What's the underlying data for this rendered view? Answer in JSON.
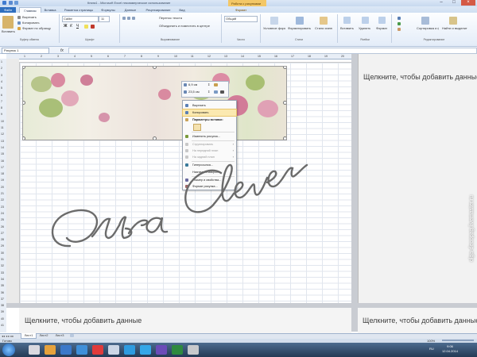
{
  "titlebar": {
    "title": "Книга1 - Microsoft Excel некоммерческое использование",
    "context_tab": "Работа с рисунками"
  },
  "tabs": {
    "file": "Файл",
    "items": [
      "Главная",
      "Вставка",
      "Разметка страницы",
      "Формулы",
      "Данные",
      "Рецензирование",
      "Вид",
      "Формат"
    ]
  },
  "ribbon": {
    "paste_label": "Вставить",
    "cut_label": "Вырезать",
    "copy_label": "Копировать",
    "format_painter_label": "Формат по образцу",
    "font_name": "Calibri",
    "font_size": "11",
    "wrap_label": "Перенос текста",
    "merge_label": "Объединить и поместить в центре",
    "number_format": "Общий",
    "conditional_label": "Условное форматирование",
    "format_table_label": "Форматировать как таблицу",
    "cell_styles_label": "Стили ячеек",
    "insert_label": "Вставить",
    "delete_label": "Удалить",
    "format_label": "Формат",
    "sort_label": "Сортировка и фильтр",
    "find_label": "Найти и выделить",
    "groups": [
      "Буфер обмена",
      "Шрифт",
      "Выравнивание",
      "Число",
      "Стили",
      "Ячейки",
      "Редактирование"
    ]
  },
  "formula_bar": {
    "name_box": "Рисунок 1",
    "fx": "fx"
  },
  "sheet": {
    "column_numbers": [
      "1",
      "2",
      "3",
      "4",
      "5",
      "6",
      "7",
      "8",
      "9",
      "10",
      "11",
      "12",
      "13",
      "14",
      "15",
      "16",
      "17",
      "18",
      "19",
      "20"
    ],
    "row_numbers": [
      "1",
      "2",
      "3",
      "4",
      "5",
      "6",
      "7",
      "8",
      "9",
      "10",
      "11",
      "12",
      "13",
      "14",
      "15",
      "16",
      "17",
      "18",
      "19",
      "20",
      "21",
      "22",
      "23",
      "24",
      "25",
      "26",
      "27",
      "28",
      "29",
      "30",
      "31",
      "32",
      "33",
      "34",
      "35",
      "36",
      "37",
      "38",
      "39",
      "40",
      "41"
    ],
    "right_hint": "Щелкните, чтобы добавить данные",
    "bottom_hint": "Щелкните, чтобы добавить данные",
    "bottom_right_hint": "Щелкните, чтобы добавить данные"
  },
  "mini_toolbar": {
    "height": "6,9 см",
    "width": "23,5 см"
  },
  "context_menu": {
    "items": [
      {
        "label": "Вырезать",
        "enabled": true,
        "icon_color": "#5a7fb5"
      },
      {
        "label": "Копировать",
        "enabled": true,
        "icon_color": "#5a7fb5",
        "highlighted": true
      },
      {
        "label": "Параметры вставки:",
        "enabled": true,
        "bold": true
      },
      {
        "label": "Изменить рисунок...",
        "enabled": true,
        "icon_color": "#7a9a3a"
      },
      {
        "label": "Сгруппировать",
        "enabled": false,
        "submenu": true
      },
      {
        "label": "На передний план",
        "enabled": false,
        "submenu": true
      },
      {
        "label": "На задний план",
        "enabled": false,
        "submenu": true
      },
      {
        "label": "Гиперссылка...",
        "enabled": true,
        "icon_color": "#3a7a9a"
      },
      {
        "label": "Назначить макрос...",
        "enabled": true
      },
      {
        "label": "Размер и свойства...",
        "enabled": true,
        "icon_color": "#6a6aa0"
      },
      {
        "label": "Формат рисунка...",
        "enabled": true,
        "icon_color": "#a06a6a"
      }
    ]
  },
  "signature_text": "Ольга Clever",
  "sheet_tabs": [
    "Лист1",
    "Лист2",
    "Лист3"
  ],
  "status": {
    "ready": "Готово",
    "zoom": "100%"
  },
  "taskbar": {
    "time": "9:06",
    "date": "12.04.2014",
    "lang": "RU"
  },
  "watermark": "olga-decopag.livemaster.ru",
  "colors": {
    "accent": "#2f6fbf",
    "context_tab": "#f3c766",
    "menu_highlight": "#fbe9b0",
    "ink": "#6b6b6b"
  }
}
